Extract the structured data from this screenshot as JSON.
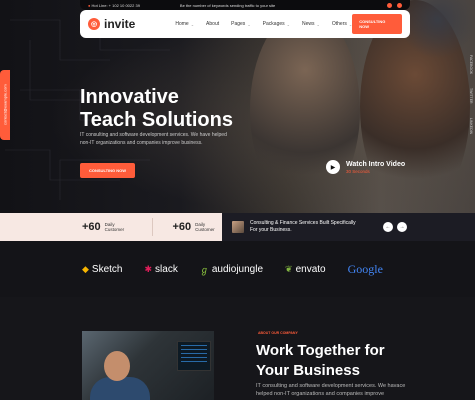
{
  "topbar": {
    "hotline": "Hot Line: + 102 10 0022 39",
    "notice": "Be the number of keywords sending traffic to your site"
  },
  "nav": {
    "logo": "invite",
    "logo_mark": "◎",
    "menu": [
      {
        "label": "Home",
        "has_dropdown": true
      },
      {
        "label": "About",
        "has_dropdown": false
      },
      {
        "label": "Pages",
        "has_dropdown": true
      },
      {
        "label": "Packages",
        "has_dropdown": true
      },
      {
        "label": "News",
        "has_dropdown": true
      },
      {
        "label": "Others",
        "has_dropdown": true
      }
    ],
    "cta": "CONSULTING NOW"
  },
  "side": {
    "left_email": "contact@example.com",
    "right_links": [
      "FACEBOOK",
      "TWITTER",
      "LINKEDIN"
    ]
  },
  "hero": {
    "title_line1": "Innovative",
    "title_line2": "Teach Solutions",
    "text": "IT consulting and software development services. We have helped non-IT organizations and companies improve business.",
    "button": "CONSULTING NOW",
    "watch_title": "Watch Intro Video",
    "watch_sub": "30 Seconds"
  },
  "stats": [
    {
      "num": "+60",
      "label": "Daily Customer"
    },
    {
      "num": "+60",
      "label": "Daily Customer"
    }
  ],
  "promo": {
    "text": "Consulting & Finance Services Built Specifically For your Business."
  },
  "brands": [
    {
      "name": "Sketch",
      "icon": "◆",
      "color": "#f7b500"
    },
    {
      "name": "slack",
      "icon": "✱",
      "color": "#e01e5a"
    },
    {
      "name": "audiojungle",
      "icon": "ℊ",
      "color": "#8dc63f"
    },
    {
      "name": "envato",
      "icon": "❦",
      "color": "#82b541"
    },
    {
      "name": "Google",
      "icon": "",
      "color": "#4285f4"
    }
  ],
  "lower": {
    "tag": "ABOUT OUR COMPANY",
    "title_line1": "Work Together for",
    "title_line2": "Your Business",
    "text": "IT consulting and software development services. We havace helped non-IT organizations and companies improve"
  }
}
